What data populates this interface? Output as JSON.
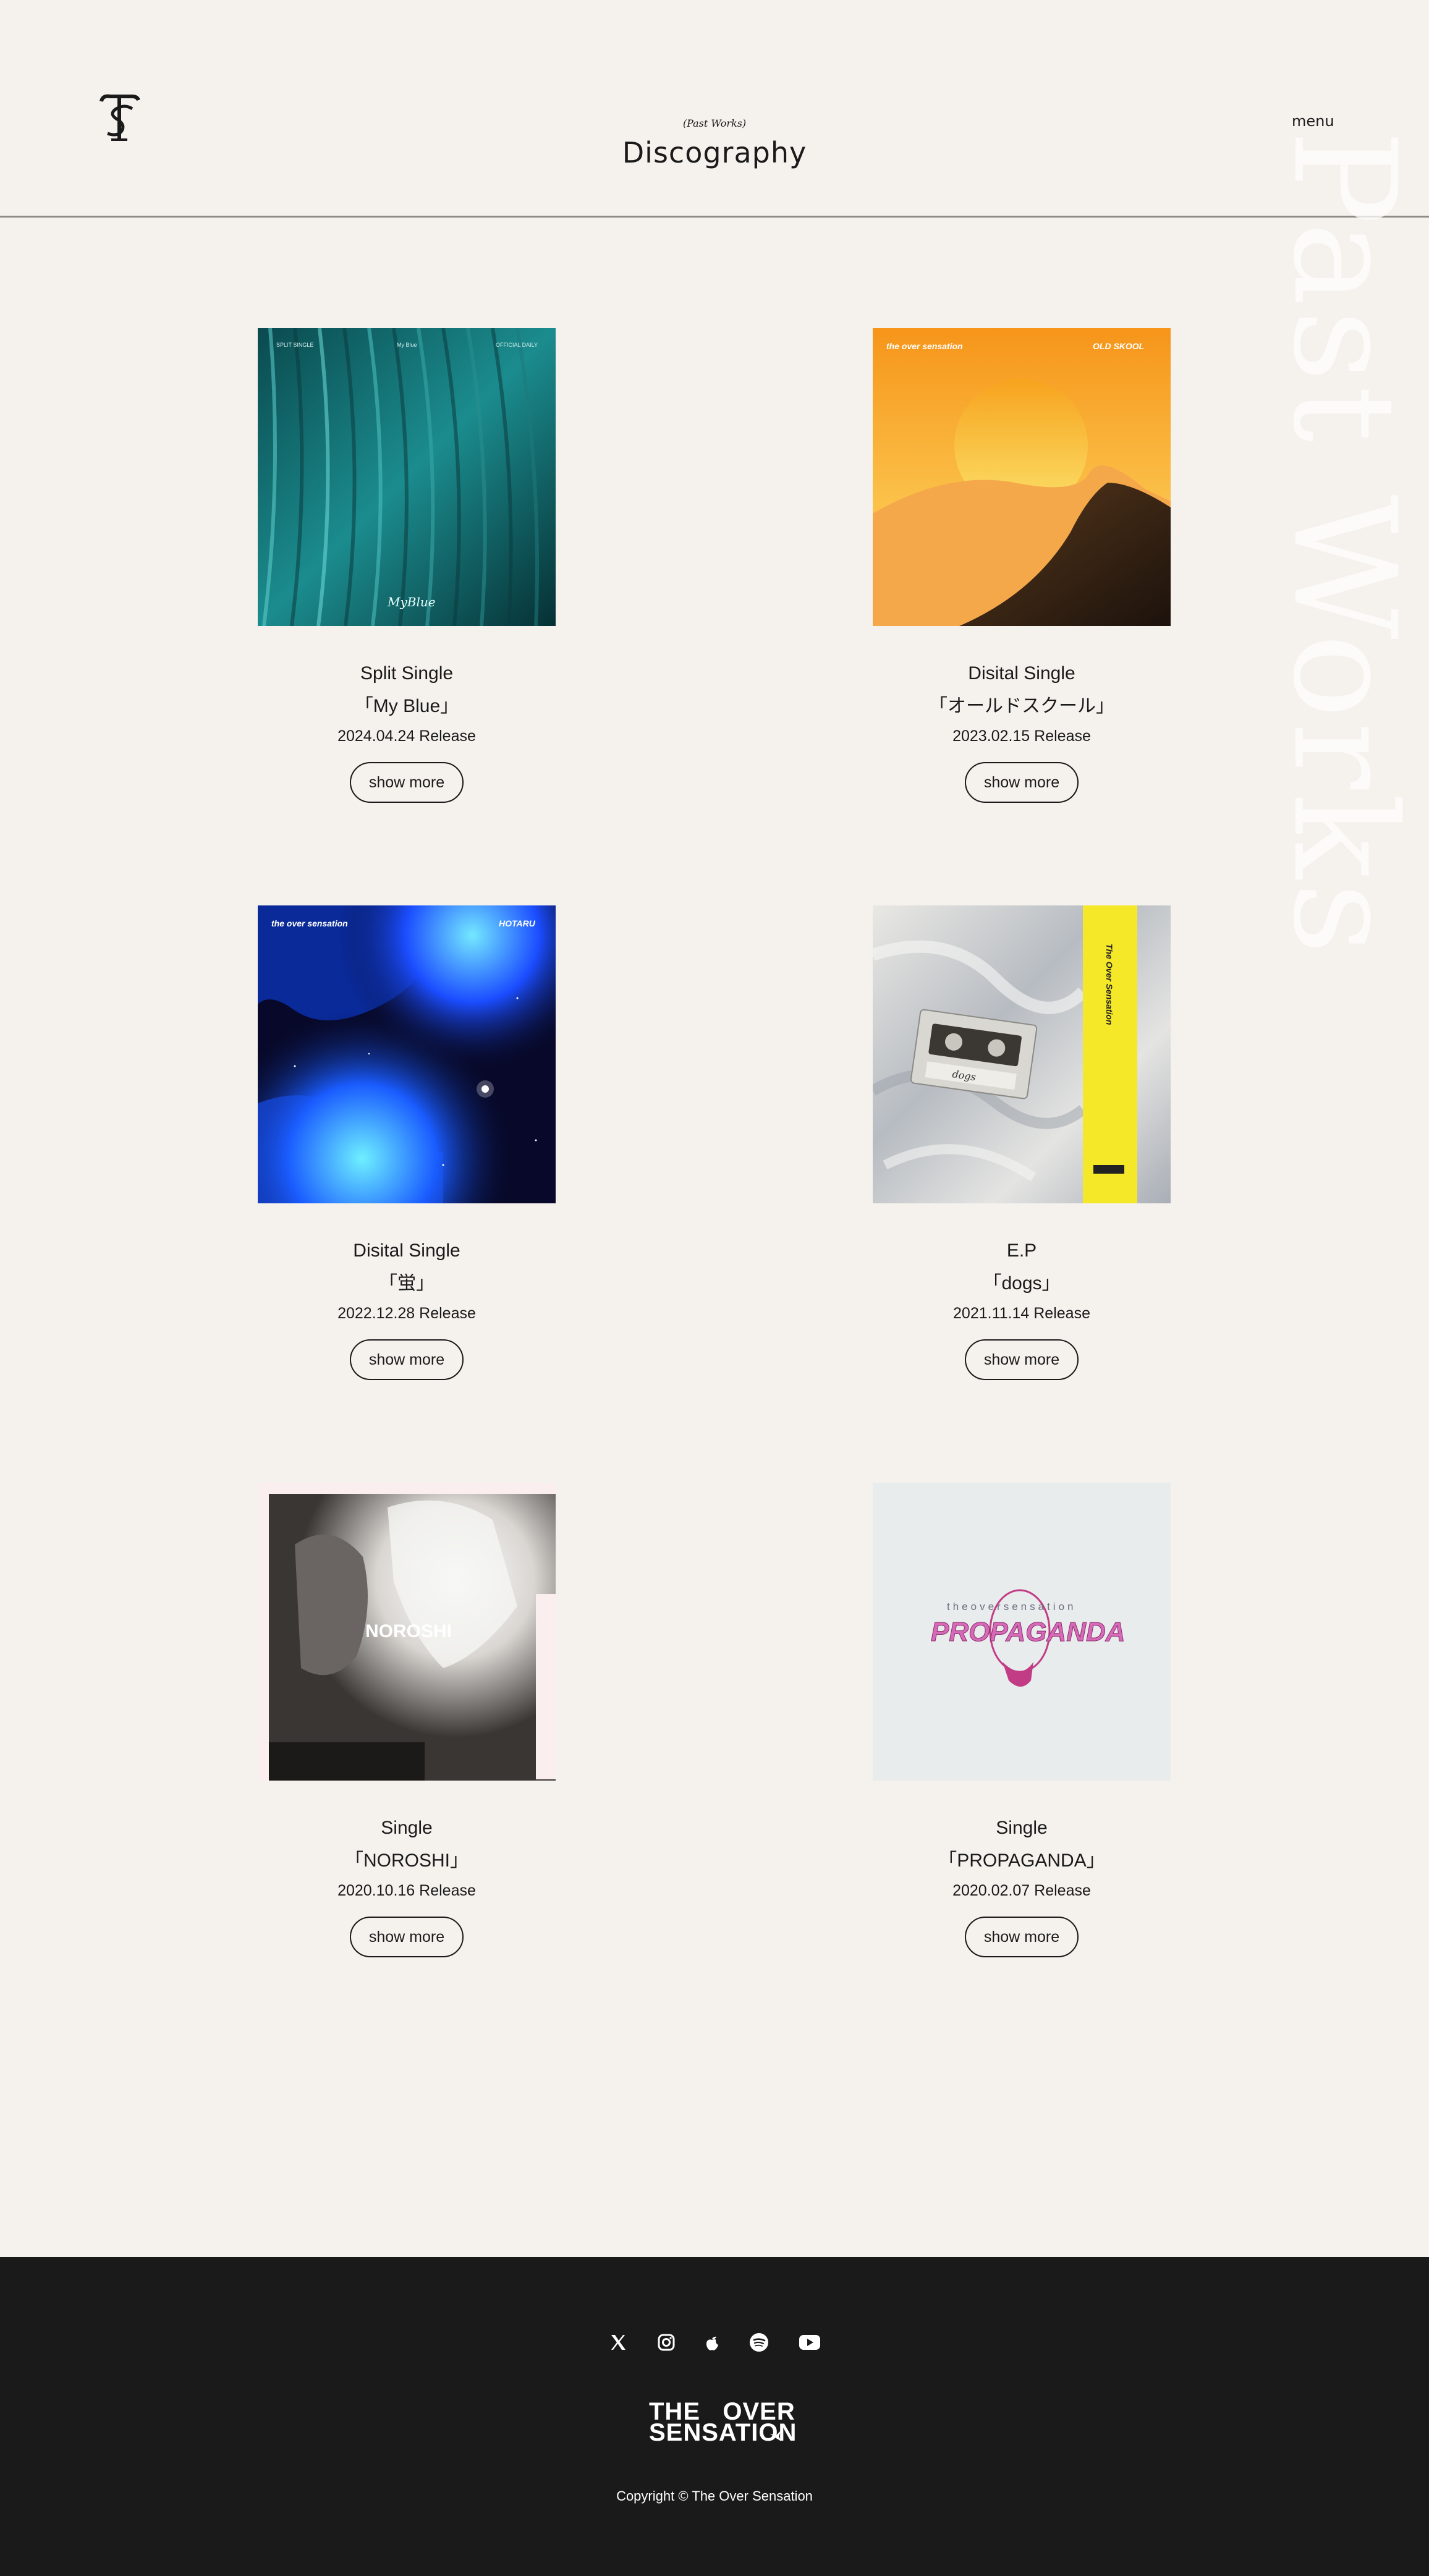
{
  "header": {
    "subtitle": "(Past Works)",
    "title": "Discography",
    "menu_label": "menu",
    "background_word": "Past Works",
    "logo_icon": "ts-monogram-logo"
  },
  "releases": [
    {
      "type": "Split Single",
      "name": "「My Blue」",
      "date": "2024.04.24 Release",
      "button": "show more",
      "cover_texts": [
        "SPLIT SINGLE",
        "My Blue",
        "OFFICIAL DAILY",
        "MyBlue"
      ]
    },
    {
      "type": "Disital Single",
      "name": "「オールドスクール」",
      "date": "2023.02.15 Release",
      "button": "show more",
      "cover_texts": [
        "the over sensation",
        "OLD SKOOL"
      ]
    },
    {
      "type": "Disital Single",
      "name": "「蛍」",
      "date": "2022.12.28 Release",
      "button": "show more",
      "cover_texts": [
        "the over sensation",
        "HOTARU"
      ]
    },
    {
      "type": "E.P",
      "name": "「dogs」",
      "date": "2021.11.14 Release",
      "button": "show more",
      "cover_texts": [
        "The Over Sensation",
        "dogs"
      ]
    },
    {
      "type": "Single",
      "name": "「NOROSHI」",
      "date": "2020.10.16 Release",
      "button": "show more",
      "cover_texts": [
        "NOROSHI"
      ]
    },
    {
      "type": "Single",
      "name": "「PROPAGANDA」",
      "date": "2020.02.07 Release",
      "button": "show more",
      "cover_texts": [
        "theoversensation",
        "PROPAGANDA"
      ]
    }
  ],
  "footer": {
    "social_icons": [
      "x-icon",
      "instagram-icon",
      "apple-music-icon",
      "spotify-icon",
      "youtube-icon"
    ],
    "brand_line1": "THE   OVER",
    "brand_line2": "SENSATION",
    "copyright": "Copyright © The Over Sensation"
  },
  "colors": {
    "background": "#f5f2ed",
    "footer": "#1a1a1a",
    "text": "#1a1a1a"
  }
}
